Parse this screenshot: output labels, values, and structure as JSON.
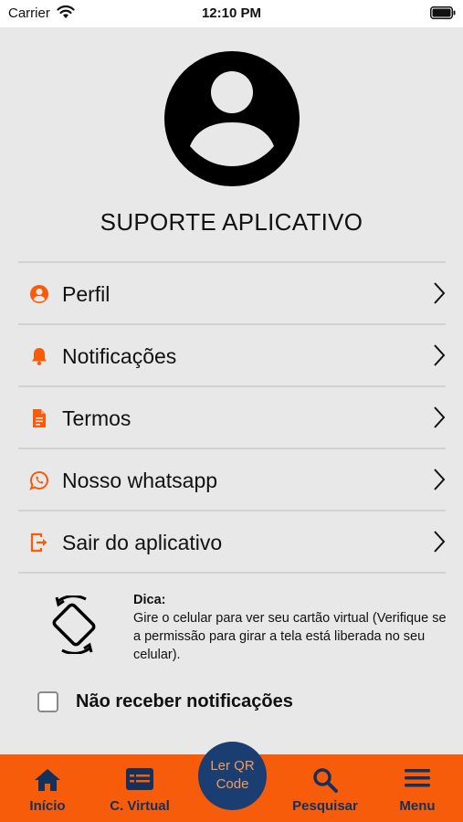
{
  "status_bar": {
    "carrier": "Carrier",
    "time": "12:10 PM"
  },
  "profile": {
    "name": "SUPORTE APLICATIVO"
  },
  "menu": {
    "items": [
      {
        "label": "Perfil",
        "icon": "user-circle-icon"
      },
      {
        "label": "Notificações",
        "icon": "bell-icon"
      },
      {
        "label": "Termos",
        "icon": "document-icon"
      },
      {
        "label": "Nosso whatsapp",
        "icon": "whatsapp-icon"
      },
      {
        "label": "Sair do aplicativo",
        "icon": "logout-icon"
      }
    ]
  },
  "tip": {
    "title": "Dica:",
    "body": "Gire o celular para ver seu cartão virtual (Verifique se a permissão para girar a tela está liberada no seu celular)."
  },
  "notifications_opt_out": {
    "label": "Não receber notificações",
    "checked": false
  },
  "tab_bar": {
    "tabs": [
      {
        "label": "Início",
        "icon": "home-icon"
      },
      {
        "label": "C. Virtual",
        "icon": "id-card-icon"
      },
      {
        "label": "Pesquisar",
        "icon": "search-icon"
      },
      {
        "label": "Menu",
        "icon": "hamburger-menu-icon"
      }
    ],
    "qr_button": {
      "line1": "Ler QR",
      "line2": "Code"
    }
  },
  "colors": {
    "accent": "#f75c0a",
    "tab_text": "#13315a",
    "qr_bg": "#1b3e72",
    "qr_text": "#f29b5c",
    "background": "#e8e8e8"
  }
}
